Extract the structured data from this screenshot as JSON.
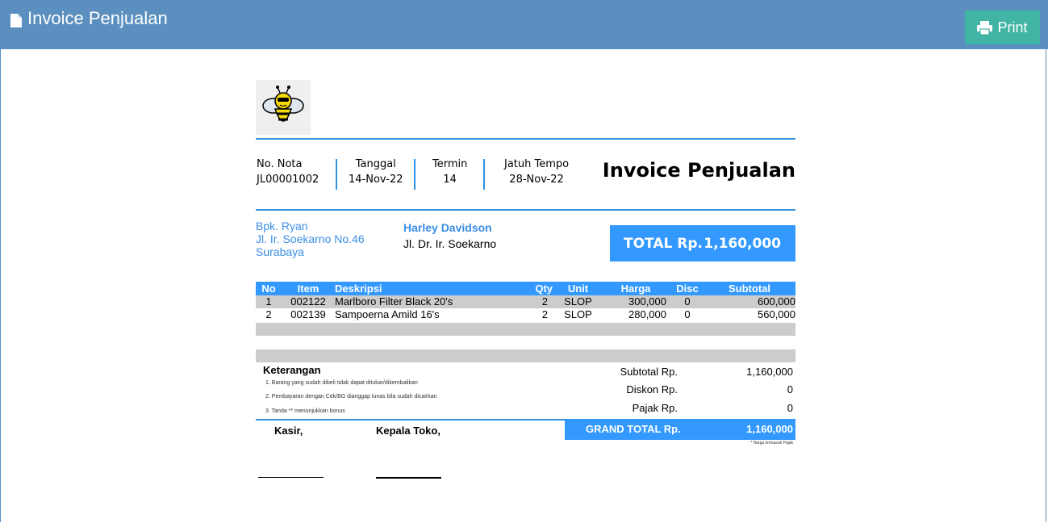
{
  "header": {
    "title": "Invoice Penjualan",
    "print_label": "Print",
    "bar_color": "#5b8fbf",
    "print_color": "#40b4a5"
  },
  "invoice": {
    "title": "Invoice Penjualan",
    "meta": [
      {
        "label": "No. Nota",
        "value": "JL00001002"
      },
      {
        "label": "Tanggal",
        "value": "14-Nov-22"
      },
      {
        "label": "Termin",
        "value": "14"
      },
      {
        "label": "Jatuh Tempo",
        "value": "28-Nov-22"
      }
    ],
    "customer": {
      "name": "Bpk. Ryan",
      "address": "Jl. Ir. Soekarno No.46",
      "city": "Surabaya"
    },
    "supplier": {
      "name": "Harley Davidson",
      "address": "Jl. Dr. Ir. Soekarno"
    },
    "total": {
      "label": "TOTAL Rp.",
      "value": "1,160,000"
    },
    "columns": [
      "No",
      "Item",
      "Deskripsi",
      "Qty",
      "Unit",
      "Harga",
      "Disc",
      "Subtotal"
    ],
    "rows": [
      {
        "no": "1",
        "item": "002122",
        "desc": "Marlboro Filter Black 20's",
        "qty": "2",
        "unit": "SLOP",
        "harga": "300,000",
        "disc": "0",
        "subtotal": "600,000"
      },
      {
        "no": "2",
        "item": "002139",
        "desc": "Sampoerna Amild 16's",
        "qty": "2",
        "unit": "SLOP",
        "harga": "280,000",
        "disc": "0",
        "subtotal": "560,000"
      }
    ],
    "keterangan": {
      "title": "Keterangan",
      "notes": [
        "1. Barang yang sudah dibeli tidak dapat ditukar/dikembalikan",
        "2. Pembayaran dengan Cek/BG dianggap lunas bila sudah dicairkan",
        "3. Tanda ** menunjukkan bonus"
      ]
    },
    "summary": {
      "subtotal_label": "Subtotal Rp.",
      "subtotal_value": "1,160,000",
      "diskon_label": "Diskon Rp.",
      "diskon_value": "0",
      "pajak_label": "Pajak Rp.",
      "pajak_value": "0",
      "grand_label": "GRAND TOTAL Rp.",
      "grand_value": "1,160,000",
      "footnote": "* Harga termasuk Pajak"
    },
    "signatures": {
      "kasir": "Kasir,",
      "kepala": "Kepala Toko,"
    }
  },
  "icons": {
    "title_icon": "document-icon",
    "print_icon": "printer-icon",
    "logo": "bee-logo-icon"
  }
}
